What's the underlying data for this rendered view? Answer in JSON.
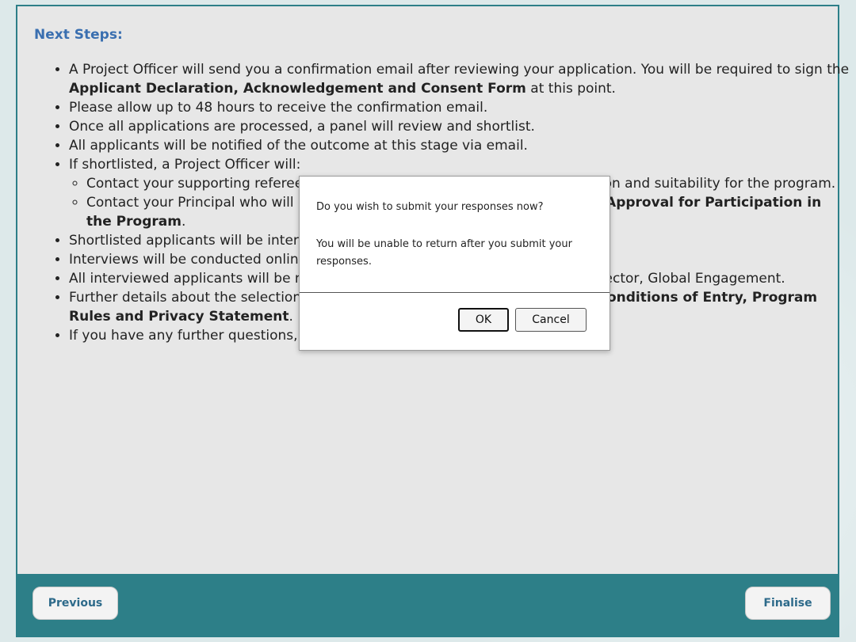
{
  "page": {
    "heading": "Next Steps:",
    "items": [
      {
        "pre": "A Project Officer will send you a confirmation email after reviewing your application. You will be required to sign the ",
        "bold": "Applicant Declaration, Acknowledgement and Consent Form",
        "post": " at this point."
      },
      {
        "text": "Please allow up to 48 hours to receive the confirmation email."
      },
      {
        "text": "Once all applications are processed, a panel will review and shortlist."
      },
      {
        "text": "All applicants will be notified of the outcome at this stage via email."
      },
      {
        "text": "If shortlisted, a Project Officer will:"
      },
      {
        "text": "Shortlisted applicants will be interviewed by the selection panel."
      },
      {
        "text": "Interviews will be conducted online via Microsoft Teams."
      },
      {
        "text": "All interviewed applicants will be notified of the outcome via email from the Director, Global Engagement."
      },
      {
        "pre": "Further details about the selection process can be found in the ",
        "bold": "Chaperones: Conditions of Entry, Program Rules and Privacy Statement",
        "post": "."
      },
      {
        "text": "If you have any further questions, contact global.engagement@qed.qld.gov.au."
      }
    ],
    "subitems": [
      {
        "text": "Contact your supporting referee, who will be asked to endorse your application and suitability for the program."
      },
      {
        "pre": "Contact your Principal who will be asked to sign the ",
        "bold": "Principal Statement - Approval for Participation in the Program",
        "post": "."
      }
    ]
  },
  "footer": {
    "previous_label": "Previous",
    "finalise_label": "Finalise"
  },
  "dialog": {
    "question": "Do you wish to submit your responses now?",
    "message": "You will be unable to return after you submit your responses.",
    "ok_label": "OK",
    "cancel_label": "Cancel"
  }
}
